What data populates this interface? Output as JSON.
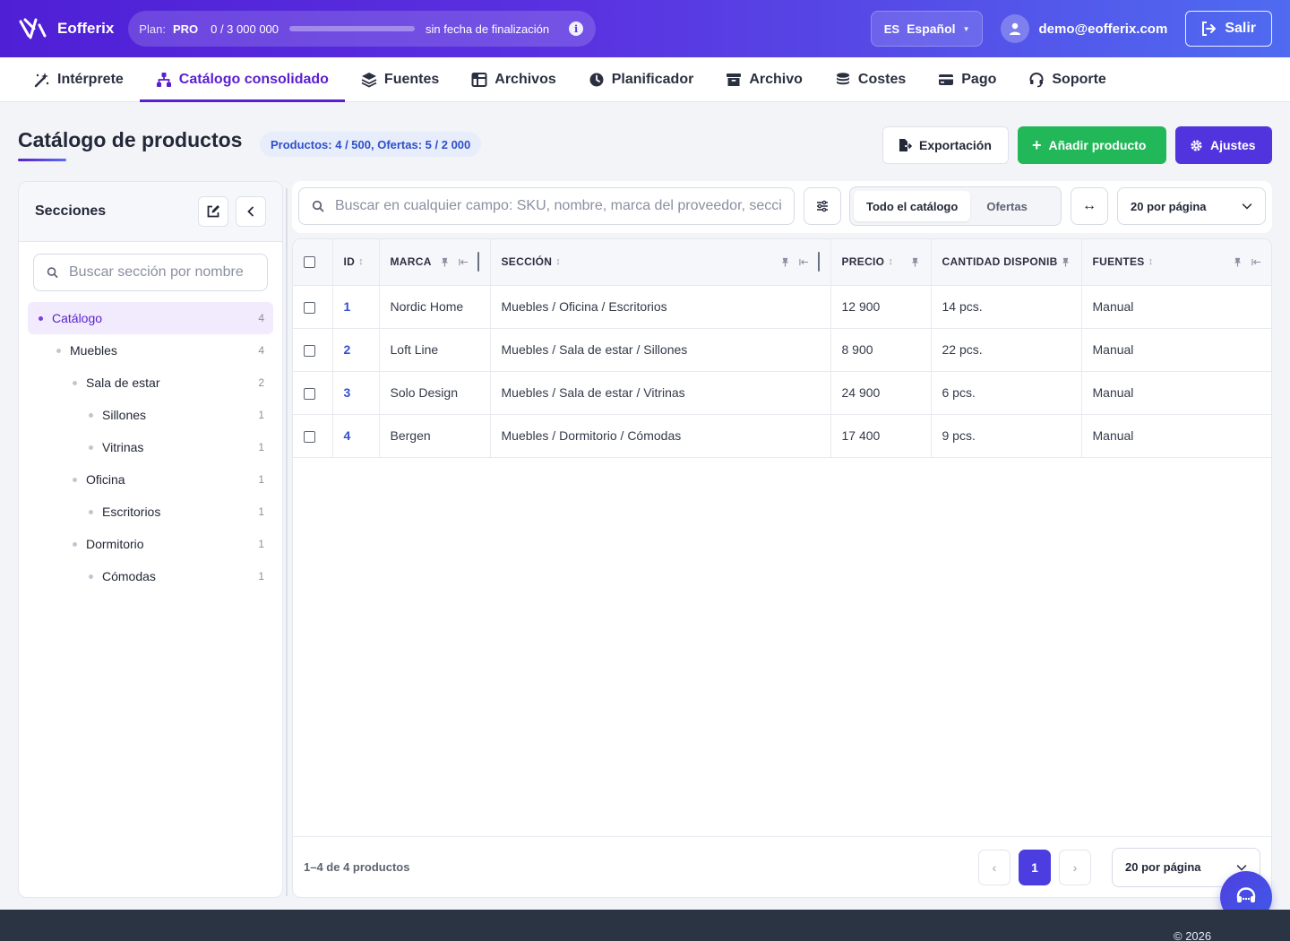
{
  "app": {
    "name": "Eofferix",
    "plan_label": "Plan:",
    "plan_value": "PRO",
    "plan_usage": "0 / 3 000 000",
    "plan_usage_fraction": 0,
    "plan_expiry": "sin fecha de finalización",
    "language_code": "ES",
    "language_name": "Español",
    "user_email": "demo@eofferix.com",
    "logout_label": "Salir"
  },
  "nav": [
    {
      "label": "Intérprete",
      "icon": "wand-icon"
    },
    {
      "label": "Catálogo consolidado",
      "icon": "sitemap-icon",
      "active": true
    },
    {
      "label": "Fuentes",
      "icon": "layers-icon"
    },
    {
      "label": "Archivos",
      "icon": "table-columns-icon"
    },
    {
      "label": "Planificador",
      "icon": "clock-icon"
    },
    {
      "label": "Archivo",
      "icon": "archive-box-icon"
    },
    {
      "label": "Costes",
      "icon": "coins-icon"
    },
    {
      "label": "Pago",
      "icon": "credit-card-icon"
    },
    {
      "label": "Soporte",
      "icon": "headset-icon"
    }
  ],
  "page": {
    "title": "Catálogo de productos",
    "stats": "Productos: 4 / 500, Ofertas: 5 / 2 000",
    "export_label": "Exportación",
    "add_label": "Añadir producto",
    "settings_label": "Ajustes"
  },
  "sidebar": {
    "title": "Secciones",
    "search_placeholder": "Buscar sección por nombre",
    "tree": [
      {
        "label": "Catálogo",
        "count": "4",
        "depth": 0,
        "active": true
      },
      {
        "label": "Muebles",
        "count": "4",
        "depth": 1
      },
      {
        "label": "Sala de estar",
        "count": "2",
        "depth": 2
      },
      {
        "label": "Sillones",
        "count": "1",
        "depth": 3
      },
      {
        "label": "Vitrinas",
        "count": "1",
        "depth": 3
      },
      {
        "label": "Oficina",
        "count": "1",
        "depth": 2
      },
      {
        "label": "Escritorios",
        "count": "1",
        "depth": 3
      },
      {
        "label": "Dormitorio",
        "count": "1",
        "depth": 2
      },
      {
        "label": "Cómodas",
        "count": "1",
        "depth": 3
      }
    ]
  },
  "toolbar": {
    "search_placeholder": "Buscar en cualquier campo: SKU, nombre, marca del proveedor, sección...",
    "scope_all": "Todo el catálogo",
    "scope_offers": "Ofertas",
    "per_page": "20 por página"
  },
  "table": {
    "columns": [
      "ID",
      "MARCA",
      "SECCIÓN",
      "PRECIO",
      "CANTIDAD DISPONIBLE",
      "FUENTES"
    ],
    "rows": [
      {
        "id": "1",
        "brand": "Nordic Home",
        "section": "Muebles / Oficina / Escritorios",
        "price": "12 900",
        "qty": "14 pcs.",
        "source": "Manual"
      },
      {
        "id": "2",
        "brand": "Loft Line",
        "section": "Muebles / Sala de estar / Sillones",
        "price": "8 900",
        "qty": "22 pcs.",
        "source": "Manual"
      },
      {
        "id": "3",
        "brand": "Solo Design",
        "section": "Muebles / Sala de estar / Vitrinas",
        "price": "24 900",
        "qty": "6 pcs.",
        "source": "Manual"
      },
      {
        "id": "4",
        "brand": "Bergen",
        "section": "Muebles / Dormitorio / Cómodas",
        "price": "17 400",
        "qty": "9 pcs.",
        "source": "Manual"
      }
    ],
    "footer_count": "1–4 de 4 productos",
    "current_page": "1",
    "prev": "‹",
    "next": "›",
    "per_page": "20 por página"
  },
  "footer": {
    "copyright": "© 2026"
  },
  "colors": {
    "brand": "#5234de",
    "accent_purple": "#5a1fd0",
    "success": "#22b859",
    "link_blue": "#3450d0"
  }
}
